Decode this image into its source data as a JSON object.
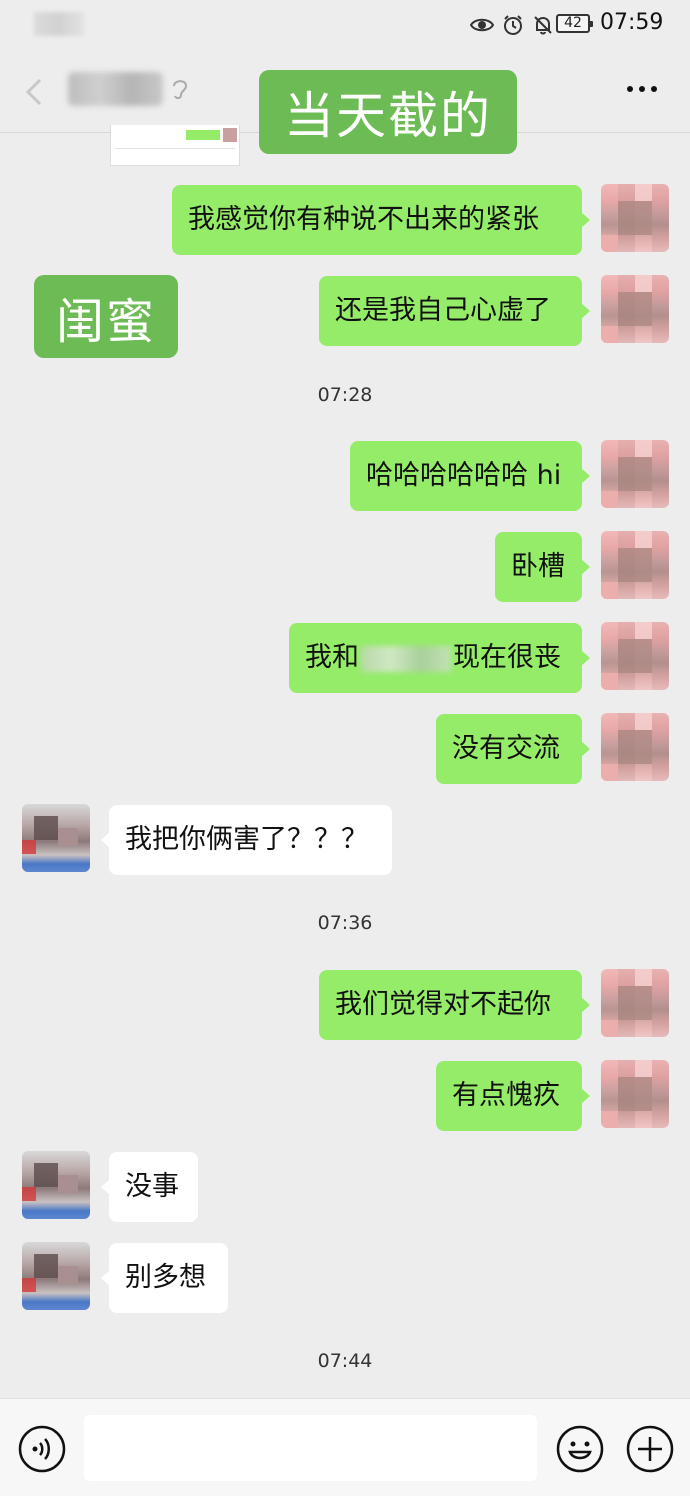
{
  "status_bar": {
    "battery_level": "42",
    "time": "07:59",
    "icons": [
      "eye-icon",
      "alarm-icon",
      "bell-off-icon",
      "battery-icon"
    ]
  },
  "header": {
    "more_icon": "more-dots-icon",
    "back_icon": "back-arrow-icon"
  },
  "overlay_labels": {
    "top": "当天截的",
    "left": "闺蜜"
  },
  "messages": [
    {
      "side": "right",
      "text": "我感觉你有种说不出来的紧张"
    },
    {
      "side": "right",
      "text": "还是我自己心虚了"
    },
    {
      "timestamp": "07:28"
    },
    {
      "side": "right",
      "text": "哈哈哈哈哈哈 hi"
    },
    {
      "side": "right",
      "text": "卧槽"
    },
    {
      "side": "right",
      "text_before": "我和",
      "text_after": "现在很丧"
    },
    {
      "side": "right",
      "text": "没有交流"
    },
    {
      "side": "left",
      "text": "我把你俩害了？？？"
    },
    {
      "timestamp": "07:36"
    },
    {
      "side": "right",
      "text": "我们觉得对不起你"
    },
    {
      "side": "right",
      "text": "有点愧疚"
    },
    {
      "side": "left",
      "text": "没事"
    },
    {
      "side": "left",
      "text": "别多想"
    },
    {
      "timestamp": "07:44"
    }
  ],
  "input": {
    "value": "",
    "placeholder": ""
  },
  "colors": {
    "sent_bubble": "#95ec69",
    "received_bubble": "#ffffff",
    "overlay_label": "#6dbb55",
    "background": "#ededed"
  }
}
